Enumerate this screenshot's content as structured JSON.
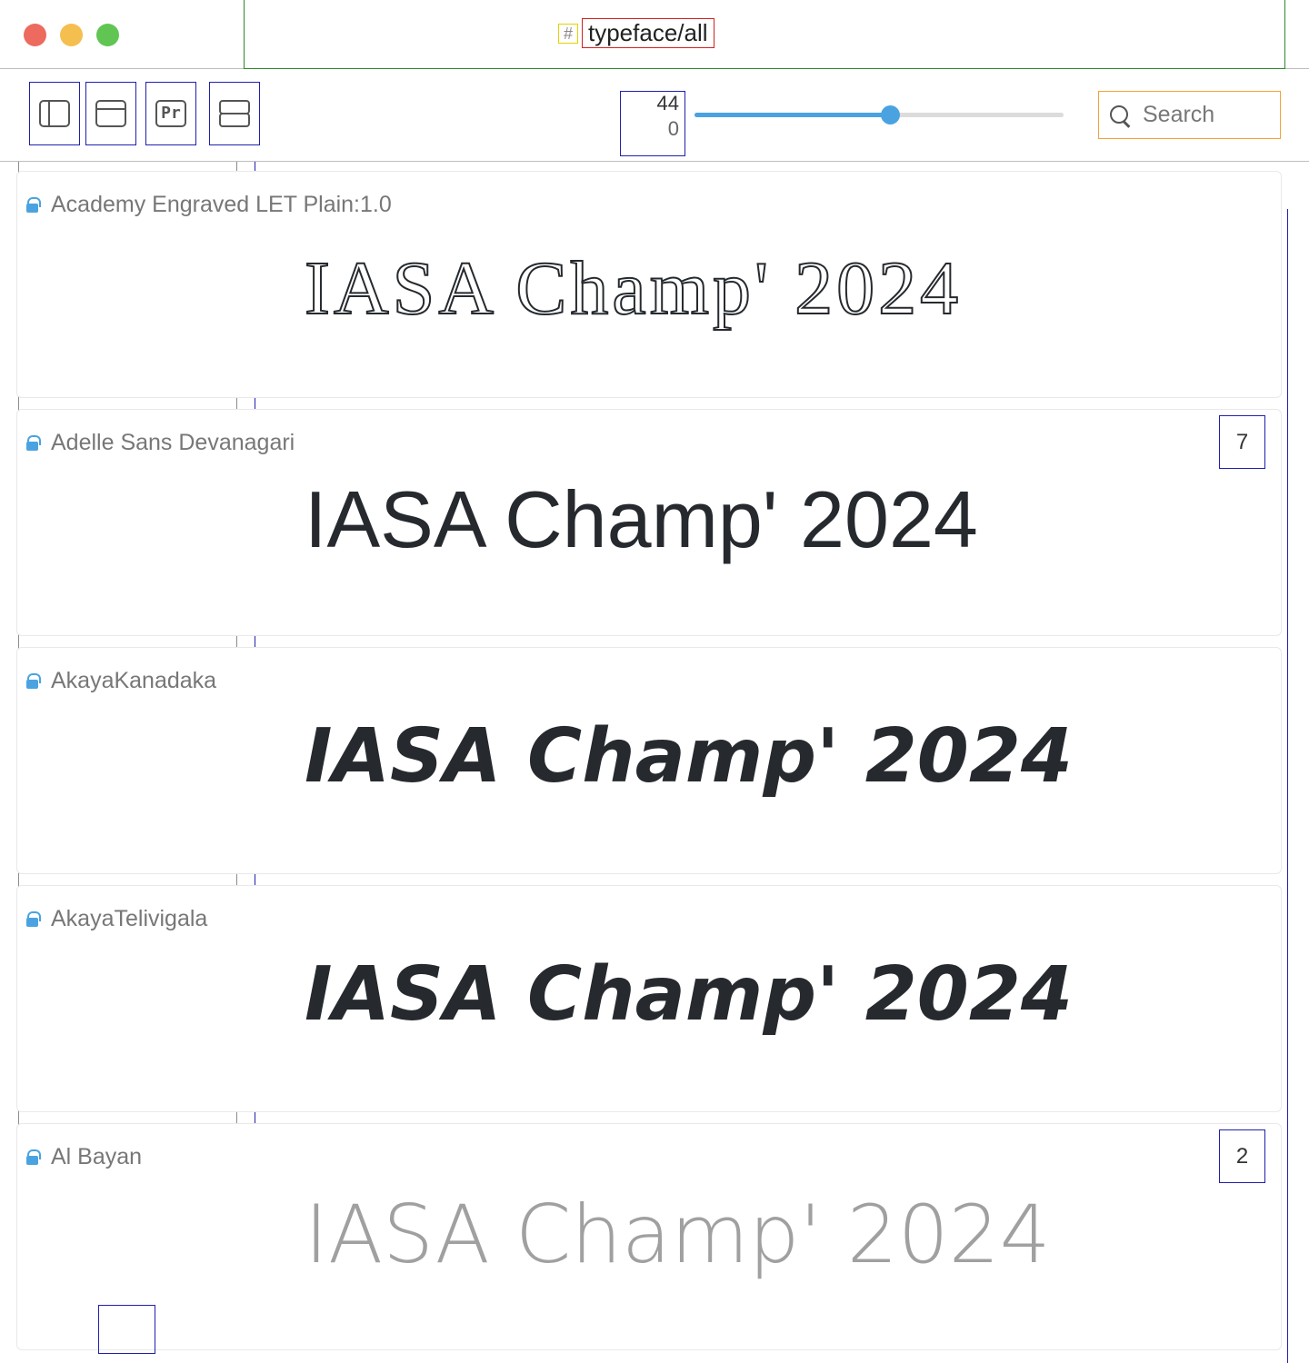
{
  "window": {
    "title": "typeface/all",
    "title_icon": "hash-icon"
  },
  "toolbar": {
    "buttons": [
      {
        "name": "sidebar-toggle",
        "icon": "sidebar-icon"
      },
      {
        "name": "window",
        "icon": "window-icon"
      },
      {
        "name": "preview-text",
        "icon": "pr-icon"
      },
      {
        "name": "layout",
        "icon": "split-icon"
      }
    ],
    "size_value": "44",
    "size_secondary": "0",
    "slider_level": 0.53,
    "search_placeholder": "Search"
  },
  "sample_text": "IASA Champ' 2024",
  "fonts": [
    {
      "name": "Academy Engraved LET Plain:1.0",
      "count": ""
    },
    {
      "name": "Adelle Sans Devanagari",
      "count": "7"
    },
    {
      "name": "AkayaKanadaka",
      "count": ""
    },
    {
      "name": "AkayaTelivigala",
      "count": ""
    },
    {
      "name": "Al Bayan",
      "count": "2"
    }
  ],
  "colors": {
    "accent": "#4aa3e0",
    "close": "#ec6a5e",
    "minimize": "#f4bf4f",
    "zoom": "#61c554"
  }
}
